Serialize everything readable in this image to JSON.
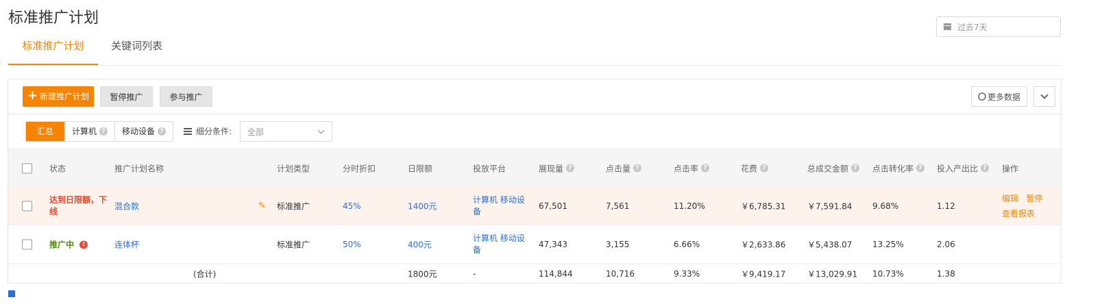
{
  "page": {
    "title": "标准推广计划"
  },
  "date_range": {
    "value": "过去7天",
    "icon": "calendar-icon"
  },
  "tabs": [
    {
      "label": "标准推广计划",
      "active": true
    },
    {
      "label": "关键词列表",
      "active": false
    }
  ],
  "toolbar": {
    "new_plan": "新建推广计划",
    "pause": "暂停推广",
    "join": "参与推广",
    "more_data": "更多数据"
  },
  "segments": [
    {
      "label": "汇总",
      "active": true
    },
    {
      "label": "计算机",
      "active": false
    },
    {
      "label": "移动设备",
      "active": false
    }
  ],
  "filter": {
    "label": "细分条件:",
    "value": "全部"
  },
  "columns": {
    "status": "状态",
    "name": "推广计划名称",
    "type": "计划类型",
    "discount": "分时折扣",
    "budget": "日限额",
    "platform": "投放平台",
    "impressions": "展现量",
    "clicks": "点击量",
    "ctr": "点击率",
    "cost": "花费",
    "gmv": "总成交金额",
    "cvr": "点击转化率",
    "roi": "投入产出比",
    "actions": "操作"
  },
  "rows": [
    {
      "status": "达到日限额，下线",
      "name": "混合款",
      "type": "标准推广",
      "discount": "45%",
      "budget": "1400元",
      "platform": "计算机 移动设备",
      "impressions": "67,501",
      "clicks": "7,561",
      "ctr": "11.20%",
      "cost": "￥6,785.31",
      "gmv": "￥7,591.84",
      "cvr": "9.68%",
      "roi": "1.12",
      "actions": {
        "edit": "编辑",
        "pause": "暂停",
        "report": "查看报表"
      }
    },
    {
      "status": "推广中",
      "name": "连体杯",
      "type": "标准推广",
      "discount": "50%",
      "budget": "400元",
      "platform": "计算机 移动设备",
      "impressions": "47,343",
      "clicks": "3,155",
      "ctr": "6.66%",
      "cost": "￥2,633.86",
      "gmv": "￥5,438.07",
      "cvr": "13.25%",
      "roi": "2.06"
    }
  ],
  "total": {
    "label": "(合计)",
    "budget": "1800元",
    "platform": "-",
    "impressions": "114,844",
    "clicks": "10,716",
    "ctr": "9.33%",
    "cost": "￥9,419.17",
    "gmv": "￥13,029.91",
    "cvr": "10.73%",
    "roi": "1.38"
  },
  "colors": {
    "accent": "#f68400",
    "link": "#2b6fd6",
    "warning": "#e24b2e",
    "success": "#4f8a10",
    "highlight_row": "#fdf3ec"
  }
}
